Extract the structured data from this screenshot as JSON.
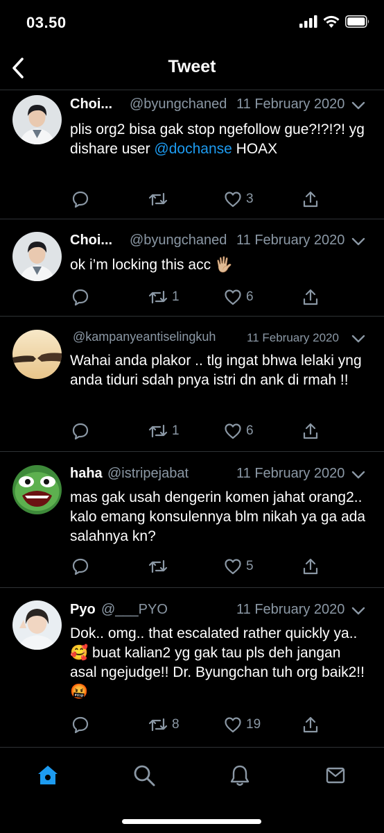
{
  "status_bar": {
    "time": "03.50"
  },
  "header": {
    "title": "Tweet"
  },
  "tweets": [
    {
      "name": "Choi...",
      "handle": "@byungchaned",
      "date": "11 February 2020",
      "text_before": "plis org2 bisa gak stop ngefollow gue?!?!?! yg dishare user ",
      "mention": "@dochanse",
      "text_after": " HOAX",
      "retweets": "",
      "likes": "3",
      "avatar_icon": "doctor-avatar"
    },
    {
      "name": "Choi...",
      "handle": "@byungchaned",
      "date": "11 February 2020",
      "text_before": "ok i’m locking this acc 🖐🏼",
      "mention": "",
      "text_after": "",
      "retweets": "1",
      "likes": "6",
      "avatar_icon": "doctor-avatar"
    },
    {
      "name": "",
      "handle": "@kampanyeantiselingkuh",
      "date": "11 February 2020",
      "text_before": "Wahai anda plakor .. tlg ingat bhwa lelaki yng anda tiduri sdah pnya istri dn ank di rmah !!",
      "mention": "",
      "text_after": "",
      "retweets": "1",
      "likes": "6",
      "avatar_icon": "holding-hands-avatar"
    },
    {
      "name": "haha",
      "handle": "@istripejabat",
      "date": "11 February 2020",
      "text_before": "mas gak usah dengerin komen jahat orang2.. kalo emang konsulennya blm nikah ya ga ada salahnya kn?",
      "mention": "",
      "text_after": "",
      "retweets": "",
      "likes": "5",
      "avatar_icon": "pepe-frog-avatar"
    },
    {
      "name": "Pyo",
      "handle": "@___PYO",
      "date": "11 February 2020",
      "text_before": "Dok.. omg.. that escalated rather quickly ya.. 🥰 buat kalian2 yg gak tau pls deh jangan asal ngejudge!! Dr. Byungchan tuh org baik2!! 🤬",
      "mention": "",
      "text_after": "",
      "retweets": "8",
      "likes": "19",
      "avatar_icon": "girl-selfie-avatar"
    }
  ],
  "tab_bar": {
    "items": [
      "home-icon",
      "search-icon",
      "notifications-icon",
      "messages-icon"
    ],
    "active": "home-icon"
  },
  "colors": {
    "background": "#000000",
    "accent": "#1d9bf0",
    "muted": "#8b98a5",
    "divider": "#2f3336"
  }
}
